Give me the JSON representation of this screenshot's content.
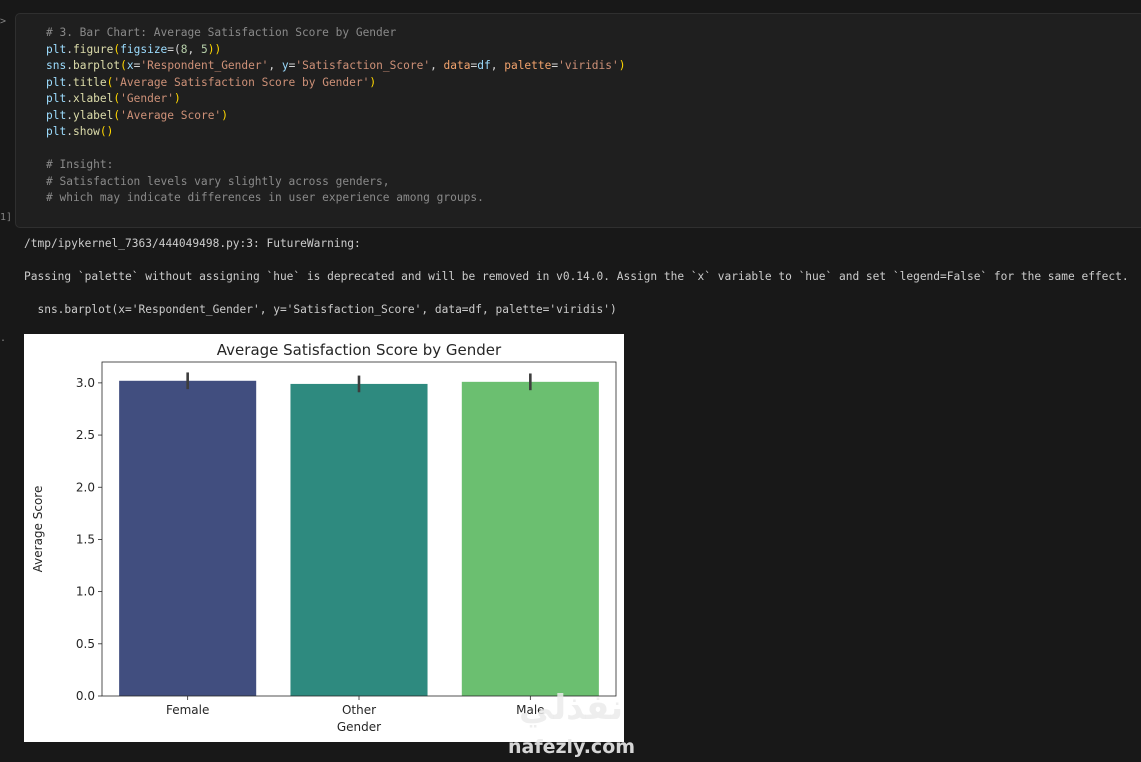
{
  "gutter": {
    "prompt": ">",
    "exec_count": "1]",
    "output_marker": "."
  },
  "code_cell": {
    "lines": [
      [
        {
          "t": "# 3. Bar Chart: Average Satisfaction Score by Gender",
          "c": "com"
        }
      ],
      [
        {
          "t": "plt",
          "c": "var"
        },
        {
          "t": ".",
          "c": "pun"
        },
        {
          "t": "figure",
          "c": "fn"
        },
        {
          "t": "(",
          "c": "par"
        },
        {
          "t": "figsize",
          "c": "var"
        },
        {
          "t": "=(",
          "c": "pun"
        },
        {
          "t": "8",
          "c": "num"
        },
        {
          "t": ", ",
          "c": "pun"
        },
        {
          "t": "5",
          "c": "num"
        },
        {
          "t": "))",
          "c": "par"
        }
      ],
      [
        {
          "t": "sns",
          "c": "var"
        },
        {
          "t": ".",
          "c": "pun"
        },
        {
          "t": "barplot",
          "c": "fn"
        },
        {
          "t": "(",
          "c": "par"
        },
        {
          "t": "x",
          "c": "var"
        },
        {
          "t": "=",
          "c": "pun"
        },
        {
          "t": "'Respondent_Gender'",
          "c": "str"
        },
        {
          "t": ", ",
          "c": "pun"
        },
        {
          "t": "y",
          "c": "var"
        },
        {
          "t": "=",
          "c": "pun"
        },
        {
          "t": "'Satisfaction_Score'",
          "c": "str"
        },
        {
          "t": ", ",
          "c": "pun"
        },
        {
          "t": "data",
          "c": "kw"
        },
        {
          "t": "=",
          "c": "pun"
        },
        {
          "t": "df",
          "c": "var"
        },
        {
          "t": ", ",
          "c": "pun"
        },
        {
          "t": "palette",
          "c": "kw"
        },
        {
          "t": "=",
          "c": "pun"
        },
        {
          "t": "'viridis'",
          "c": "str"
        },
        {
          "t": ")",
          "c": "par"
        }
      ],
      [
        {
          "t": "plt",
          "c": "var"
        },
        {
          "t": ".",
          "c": "pun"
        },
        {
          "t": "title",
          "c": "fn"
        },
        {
          "t": "(",
          "c": "par"
        },
        {
          "t": "'Average Satisfaction Score by Gender'",
          "c": "str"
        },
        {
          "t": ")",
          "c": "par"
        }
      ],
      [
        {
          "t": "plt",
          "c": "var"
        },
        {
          "t": ".",
          "c": "pun"
        },
        {
          "t": "xlabel",
          "c": "fn"
        },
        {
          "t": "(",
          "c": "par"
        },
        {
          "t": "'Gender'",
          "c": "str"
        },
        {
          "t": ")",
          "c": "par"
        }
      ],
      [
        {
          "t": "plt",
          "c": "var"
        },
        {
          "t": ".",
          "c": "pun"
        },
        {
          "t": "ylabel",
          "c": "fn"
        },
        {
          "t": "(",
          "c": "par"
        },
        {
          "t": "'Average Score'",
          "c": "str"
        },
        {
          "t": ")",
          "c": "par"
        }
      ],
      [
        {
          "t": "plt",
          "c": "var"
        },
        {
          "t": ".",
          "c": "pun"
        },
        {
          "t": "show",
          "c": "fn"
        },
        {
          "t": "()",
          "c": "par"
        }
      ],
      [],
      [
        {
          "t": "# Insight:",
          "c": "com"
        }
      ],
      [
        {
          "t": "# Satisfaction levels vary slightly across genders,",
          "c": "com"
        }
      ],
      [
        {
          "t": "# which may indicate differences in user experience among groups.",
          "c": "com"
        }
      ]
    ]
  },
  "output": {
    "warning_path": "/tmp/ipykernel_7363/444049498.py:3: FutureWarning:",
    "warning_message": "Passing `palette` without assigning `hue` is deprecated and will be removed in v0.14.0. Assign the `x` variable to `hue` and set `legend=False` for the same effect.",
    "warning_source": "  sns.barplot(x='Respondent_Gender', y='Satisfaction_Score', data=df, palette='viridis')"
  },
  "chart_data": {
    "type": "bar",
    "title": "Average Satisfaction Score by Gender",
    "xlabel": "Gender",
    "ylabel": "Average Score",
    "categories": [
      "Female",
      "Other",
      "Male"
    ],
    "values": [
      3.02,
      2.99,
      3.01
    ],
    "error_bars": [
      [
        2.94,
        3.1
      ],
      [
        2.91,
        3.07
      ],
      [
        2.93,
        3.09
      ]
    ],
    "colors": [
      "#414e7f",
      "#2e8a7f",
      "#6bbf70"
    ],
    "ylim": [
      0,
      3.2
    ],
    "yticks": [
      "0.0",
      "0.5",
      "1.0",
      "1.5",
      "2.0",
      "2.5",
      "3.0"
    ],
    "grid": false,
    "legend": false
  },
  "watermark": {
    "arabic": "نفذلي",
    "latin": "nafezly.com"
  }
}
